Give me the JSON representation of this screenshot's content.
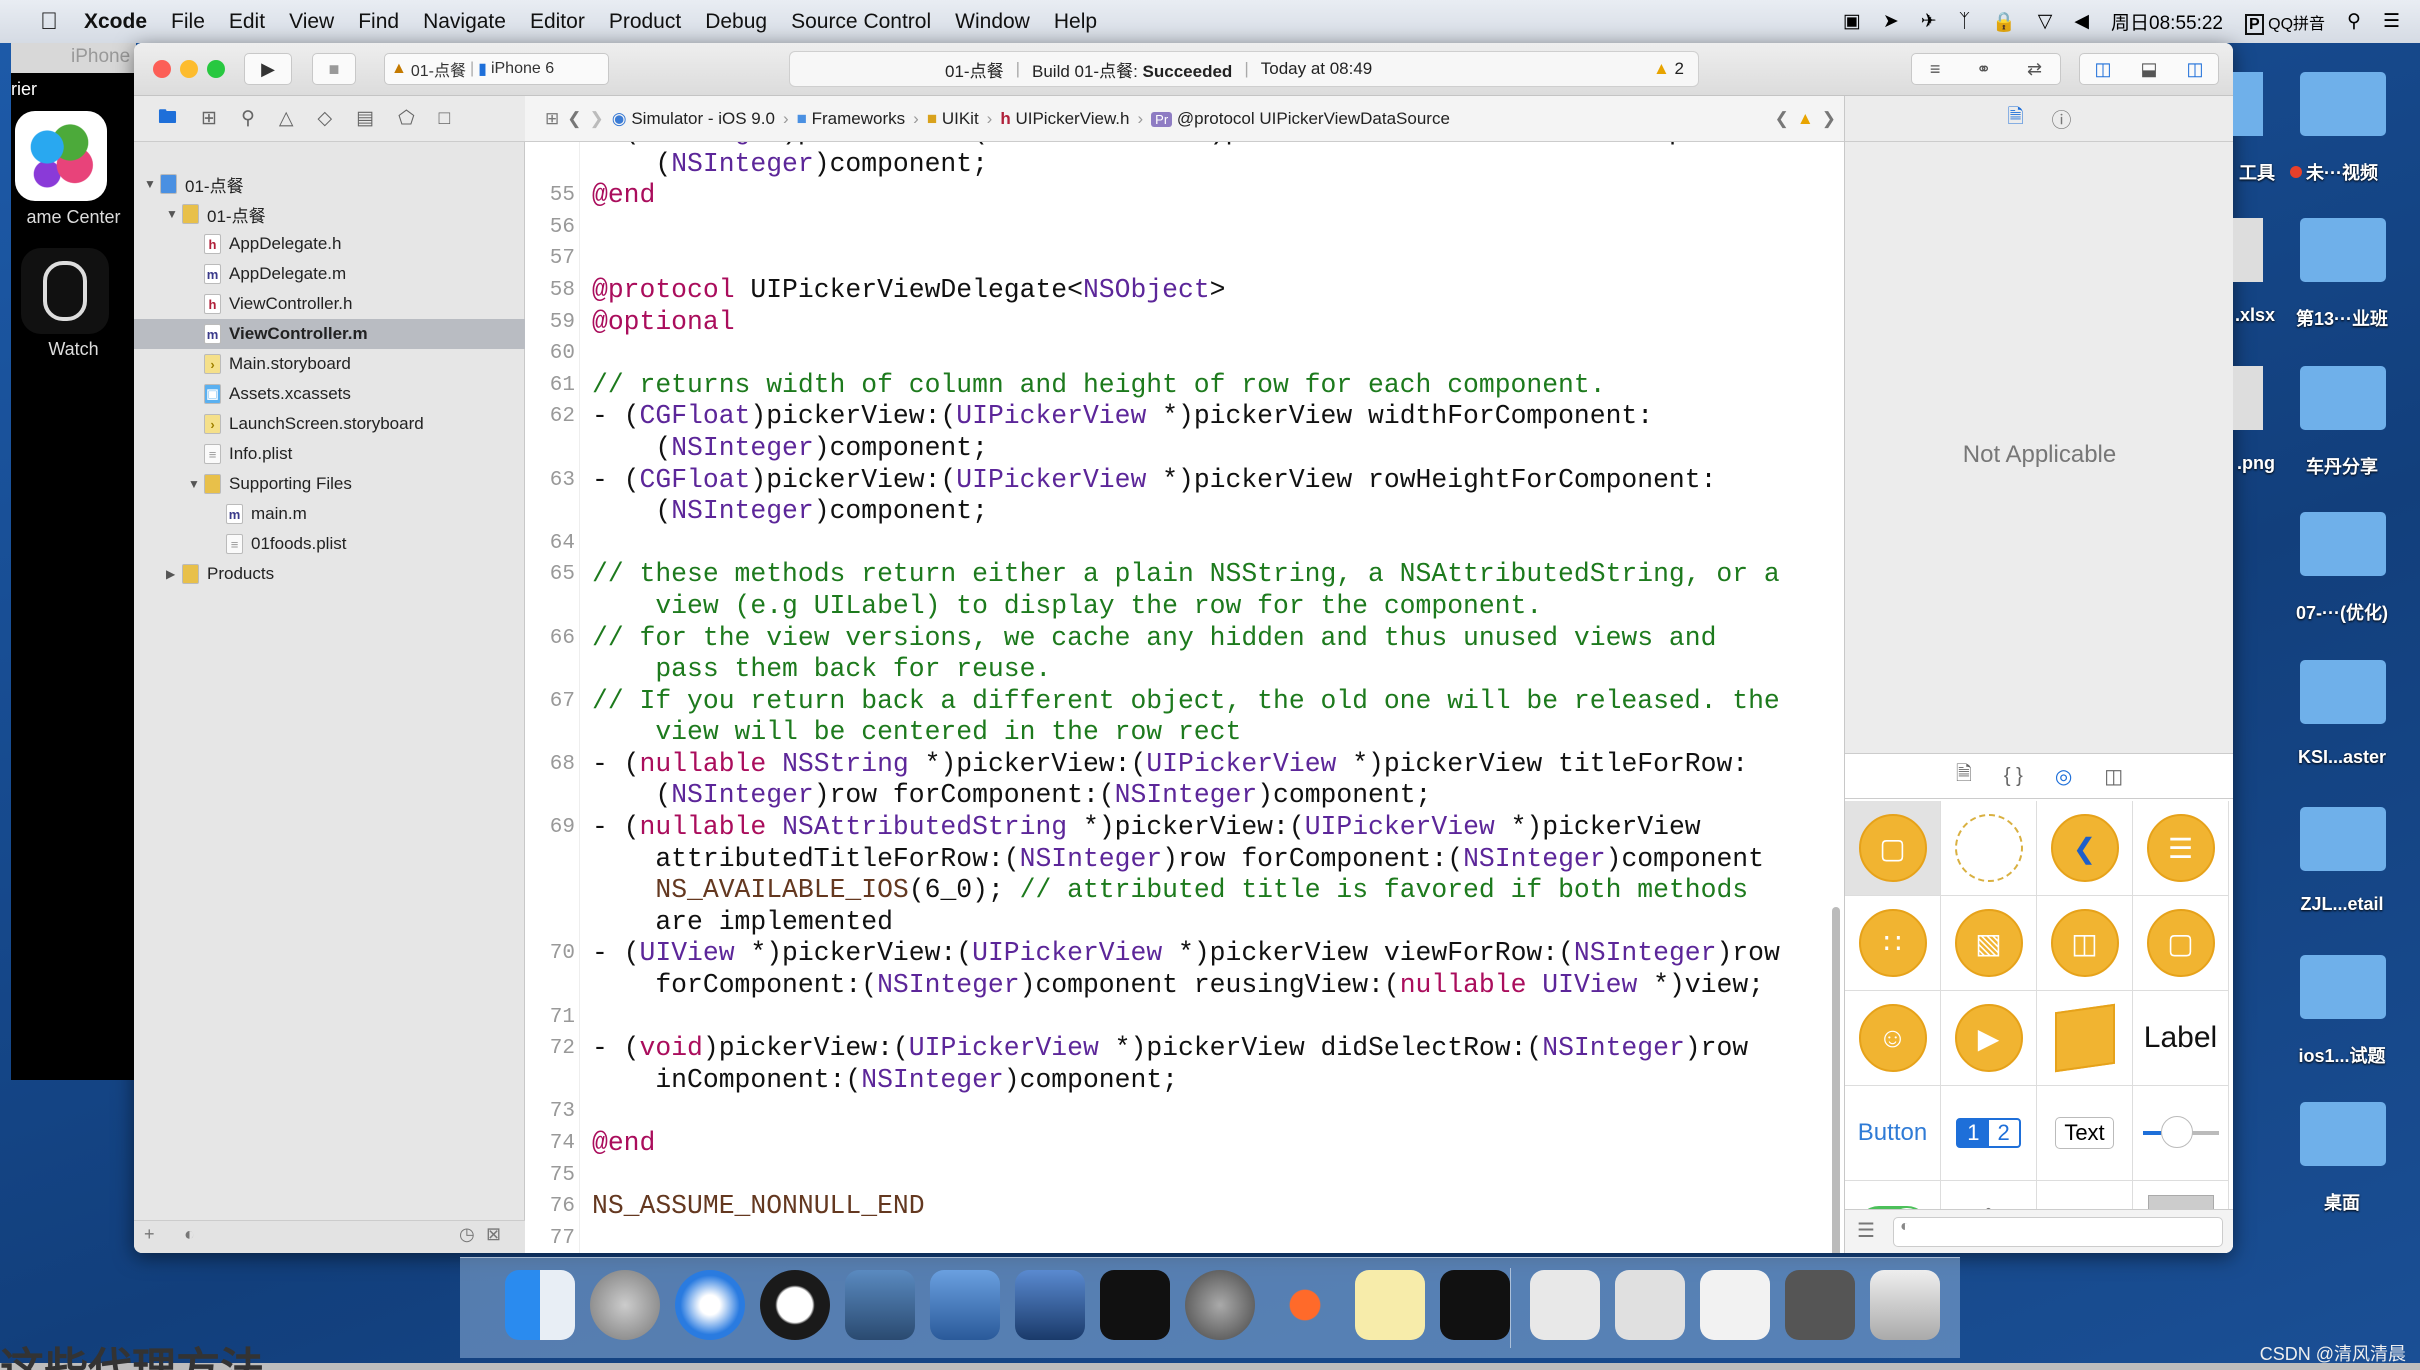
{
  "menubar": {
    "app": "Xcode",
    "items": [
      "File",
      "Edit",
      "View",
      "Find",
      "Navigate",
      "Editor",
      "Product",
      "Debug",
      "Source Control",
      "Window",
      "Help"
    ],
    "clock": "周日08:55:22",
    "input_method": "QQ拼音"
  },
  "simulator": {
    "title": "iPhone",
    "carrier": "rier",
    "apps": [
      {
        "label": "ame Center",
        "icon": "game-center-icon"
      },
      {
        "label": "Watch",
        "icon": "watch-icon"
      }
    ]
  },
  "toolbar": {
    "scheme": "01-点餐",
    "device": "iPhone 6",
    "activity": {
      "project": "01-点餐",
      "build_prefix": "Build 01-点餐: ",
      "build_status": "Succeeded",
      "time": "Today at 08:49",
      "warnings": "2"
    }
  },
  "jumpbar": [
    "Simulator - iOS 9.0",
    "Frameworks",
    "UIKit",
    "UIPickerView.h",
    "@protocol UIPickerViewDataSource"
  ],
  "navigator": {
    "items": [
      {
        "label": "01-点餐",
        "level": 0,
        "type": "project",
        "open": true
      },
      {
        "label": "01-点餐",
        "level": 1,
        "type": "folder",
        "open": true
      },
      {
        "label": "AppDelegate.h",
        "level": 2,
        "type": "h"
      },
      {
        "label": "AppDelegate.m",
        "level": 2,
        "type": "m"
      },
      {
        "label": "ViewController.h",
        "level": 2,
        "type": "h"
      },
      {
        "label": "ViewController.m",
        "level": 2,
        "type": "m",
        "selected": true
      },
      {
        "label": "Main.storyboard",
        "level": 2,
        "type": "sb"
      },
      {
        "label": "Assets.xcassets",
        "level": 2,
        "type": "assets"
      },
      {
        "label": "LaunchScreen.storyboard",
        "level": 2,
        "type": "sb"
      },
      {
        "label": "Info.plist",
        "level": 2,
        "type": "plist"
      },
      {
        "label": "Supporting Files",
        "level": 2,
        "type": "folder",
        "open": true
      },
      {
        "label": "main.m",
        "level": 3,
        "type": "m"
      },
      {
        "label": "01foods.plist",
        "level": 3,
        "type": "plist"
      },
      {
        "label": "Products",
        "level": 1,
        "type": "folder",
        "open": false
      }
    ]
  },
  "code": [
    {
      "n": "",
      "t": "- (NSInteger)pickerView:(UIPickerView *)pickerView numberOfRowsInComponent:"
    },
    {
      "n": "",
      "t": "    (NSInteger)component;"
    },
    {
      "n": "55",
      "t": "@end"
    },
    {
      "n": "56",
      "t": ""
    },
    {
      "n": "57",
      "t": ""
    },
    {
      "n": "58",
      "t": "@protocol UIPickerViewDelegate<NSObject>"
    },
    {
      "n": "59",
      "t": "@optional"
    },
    {
      "n": "60",
      "t": ""
    },
    {
      "n": "61",
      "t": "// returns width of column and height of row for each component."
    },
    {
      "n": "62",
      "t": "- (CGFloat)pickerView:(UIPickerView *)pickerView widthForComponent:"
    },
    {
      "n": "",
      "t": "    (NSInteger)component;"
    },
    {
      "n": "63",
      "t": "- (CGFloat)pickerView:(UIPickerView *)pickerView rowHeightForComponent:"
    },
    {
      "n": "",
      "t": "    (NSInteger)component;"
    },
    {
      "n": "64",
      "t": ""
    },
    {
      "n": "65",
      "t": "// these methods return either a plain NSString, a NSAttributedString, or a"
    },
    {
      "n": "",
      "t": "    view (e.g UILabel) to display the row for the component."
    },
    {
      "n": "66",
      "t": "// for the view versions, we cache any hidden and thus unused views and"
    },
    {
      "n": "",
      "t": "    pass them back for reuse."
    },
    {
      "n": "67",
      "t": "// If you return back a different object, the old one will be released. the"
    },
    {
      "n": "",
      "t": "    view will be centered in the row rect"
    },
    {
      "n": "68",
      "t": "- (nullable NSString *)pickerView:(UIPickerView *)pickerView titleForRow:"
    },
    {
      "n": "",
      "t": "    (NSInteger)row forComponent:(NSInteger)component;"
    },
    {
      "n": "69",
      "t": "- (nullable NSAttributedString *)pickerView:(UIPickerView *)pickerView"
    },
    {
      "n": "",
      "t": "    attributedTitleForRow:(NSInteger)row forComponent:(NSInteger)component"
    },
    {
      "n": "",
      "t": "    NS_AVAILABLE_IOS(6_0); // attributed title is favored if both methods"
    },
    {
      "n": "",
      "t": "    are implemented"
    },
    {
      "n": "70",
      "t": "- (UIView *)pickerView:(UIPickerView *)pickerView viewForRow:(NSInteger)row"
    },
    {
      "n": "",
      "t": "    forComponent:(NSInteger)component reusingView:(nullable UIView *)view;"
    },
    {
      "n": "71",
      "t": ""
    },
    {
      "n": "72",
      "t": "- (void)pickerView:(UIPickerView *)pickerView didSelectRow:(NSInteger)row"
    },
    {
      "n": "",
      "t": "    inComponent:(NSInteger)component;"
    },
    {
      "n": "73",
      "t": ""
    },
    {
      "n": "74",
      "t": "@end"
    },
    {
      "n": "75",
      "t": ""
    },
    {
      "n": "76",
      "t": "NS_ASSUME_NONNULL_END"
    },
    {
      "n": "77",
      "t": ""
    }
  ],
  "inspector": {
    "status": "Not Applicable"
  },
  "library": {
    "items": [
      "view-controller-icon",
      "storyboard-reference-icon",
      "navigation-controller-icon",
      "table-view-controller-icon",
      "collection-view-controller-icon",
      "tab-bar-controller-icon",
      "split-view-controller-icon",
      "page-view-controller-icon",
      "glkit-view-controller-icon",
      "av-player-view-controller-icon",
      "object-icon",
      "Label",
      "Button",
      "segmented-control",
      "Text",
      "slider-icon",
      "switch-icon",
      "activity-indicator-icon",
      "progress-view-icon",
      "page-control-icon"
    ],
    "label_text": "Label",
    "button_text": "Button",
    "segment_1": "1",
    "segment_2": "2",
    "textfield_text": "Text"
  },
  "desktop": {
    "items": [
      "工具",
      "未···视频",
      ".xlsx",
      "第13···业班",
      ".png",
      "车丹分享",
      "07-···(优化)",
      "KSI...aster",
      "ZJL...etail",
      "ios1...试题",
      "桌面"
    ]
  },
  "dock": [
    "finder-icon",
    "launchpad-icon",
    "safari-icon",
    "mouse-icon",
    "photo-booth-icon",
    "xcode-icon",
    "instruments-icon",
    "terminal-icon",
    "system-preferences-icon",
    "powerpoint-icon",
    "notes-icon",
    "console-icon",
    "stack-1-icon",
    "stack-2-icon",
    "stack-3-icon",
    "stack-4-icon",
    "trash-icon"
  ],
  "caption": "这些代理方法",
  "watermark": "CSDN @清风清晨",
  "colors": {
    "desktop": "#1a4f95",
    "keyword": "#aa0d5c",
    "type": "#5c2699",
    "comment": "#1d7a1d",
    "library_orange": "#f1b431"
  }
}
